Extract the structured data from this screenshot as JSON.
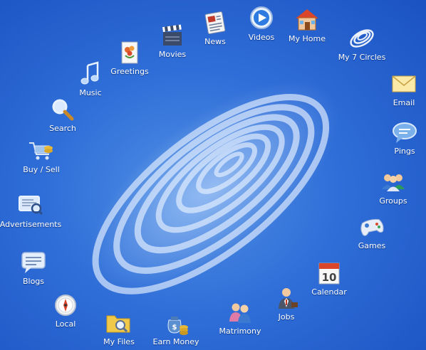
{
  "desktop": {
    "items": [
      {
        "label": "News",
        "icon": "news-icon",
        "name": "news"
      },
      {
        "label": "Videos",
        "icon": "play-icon",
        "name": "videos"
      },
      {
        "label": "My Home",
        "icon": "home-icon",
        "name": "my-home"
      },
      {
        "label": "My 7 Circles",
        "icon": "circles-icon",
        "name": "my-7-circles"
      },
      {
        "label": "Movies",
        "icon": "clapperboard-icon",
        "name": "movies"
      },
      {
        "label": "Greetings",
        "icon": "greeting-card-icon",
        "name": "greetings"
      },
      {
        "label": "Music",
        "icon": "music-note-icon",
        "name": "music"
      },
      {
        "label": "Email",
        "icon": "envelope-icon",
        "name": "email"
      },
      {
        "label": "Search",
        "icon": "magnifier-icon",
        "name": "search"
      },
      {
        "label": "Pings",
        "icon": "chat-bubble-icon",
        "name": "pings"
      },
      {
        "label": "Buy / Sell",
        "icon": "shopping-cart-icon",
        "name": "buy-sell"
      },
      {
        "label": "Groups",
        "icon": "group-icon",
        "name": "groups"
      },
      {
        "label": "Advertisements",
        "icon": "ad-monitor-icon",
        "name": "advertisements"
      },
      {
        "label": "Games",
        "icon": "gamepad-icon",
        "name": "games"
      },
      {
        "label": "Blogs",
        "icon": "blog-bubble-icon",
        "name": "blogs"
      },
      {
        "label": "Calendar",
        "icon": "calendar-icon",
        "name": "calendar"
      },
      {
        "label": "Local",
        "icon": "compass-icon",
        "name": "local"
      },
      {
        "label": "Jobs",
        "icon": "businessman-icon",
        "name": "jobs"
      },
      {
        "label": "Matrimony",
        "icon": "couple-icon",
        "name": "matrimony"
      },
      {
        "label": "My Files",
        "icon": "folder-search-icon",
        "name": "my-files"
      },
      {
        "label": "Earn Money",
        "icon": "money-bag-icon",
        "name": "earn-money"
      }
    ],
    "calendar_day": "10"
  },
  "colors": {
    "background_center": "#4f8fe4",
    "background_edge": "#1b52c2",
    "label": "#ffffff"
  }
}
